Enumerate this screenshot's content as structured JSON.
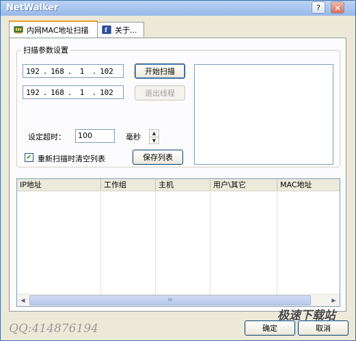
{
  "window": {
    "title": "NetWalker"
  },
  "title_buttons": {
    "help": "?",
    "close": "×"
  },
  "tabs": [
    {
      "label": "内网MAC地址扫描",
      "icon": "network-card-icon"
    },
    {
      "label": "关于...",
      "icon": "info-icon"
    }
  ],
  "scan_group": {
    "title": "扫描参数设置",
    "start_ip": [
      "192",
      "168",
      "1",
      "102"
    ],
    "end_ip": [
      "192",
      "168",
      "1",
      "102"
    ],
    "start_button": "开始扫描",
    "stop_button": "退出线程",
    "timeout_label": "设定超时：",
    "timeout_value": "100",
    "timeout_unit": "毫秒",
    "clear_checkbox_label": "重新扫描时清空列表",
    "clear_checked": true,
    "save_button": "保存列表"
  },
  "list": {
    "columns": [
      "IP地址",
      "工作组",
      "主机",
      "用户\\其它",
      "MAC地址"
    ],
    "scroll_thumb": "III"
  },
  "footer": {
    "ok_button": "确定",
    "cancel_button": "取消",
    "watermark_qq": "QQ:414876194",
    "watermark_site": "极速下载站"
  }
}
